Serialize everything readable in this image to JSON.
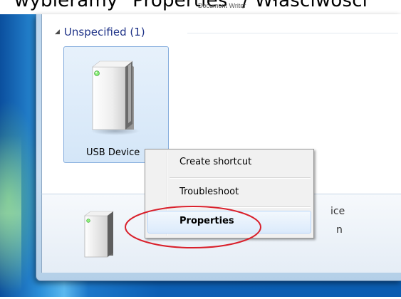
{
  "caption": {
    "text": "wybieramy \"Properties\" / Właściwości",
    "sub_text": "Document Writer"
  },
  "group": {
    "label": "Unspecified (1)"
  },
  "device": {
    "label": "USB Device",
    "icon": "usb-drive-icon"
  },
  "context_menu": {
    "items": [
      {
        "label": "Create shortcut"
      },
      {
        "label": "Troubleshoot"
      },
      {
        "label": "Properties"
      }
    ]
  },
  "details": {
    "line1": "ice",
    "line2": "n"
  },
  "colors": {
    "annotation": "#d9202b",
    "group_text": "#1e3287",
    "tile_border": "#84acdd"
  }
}
